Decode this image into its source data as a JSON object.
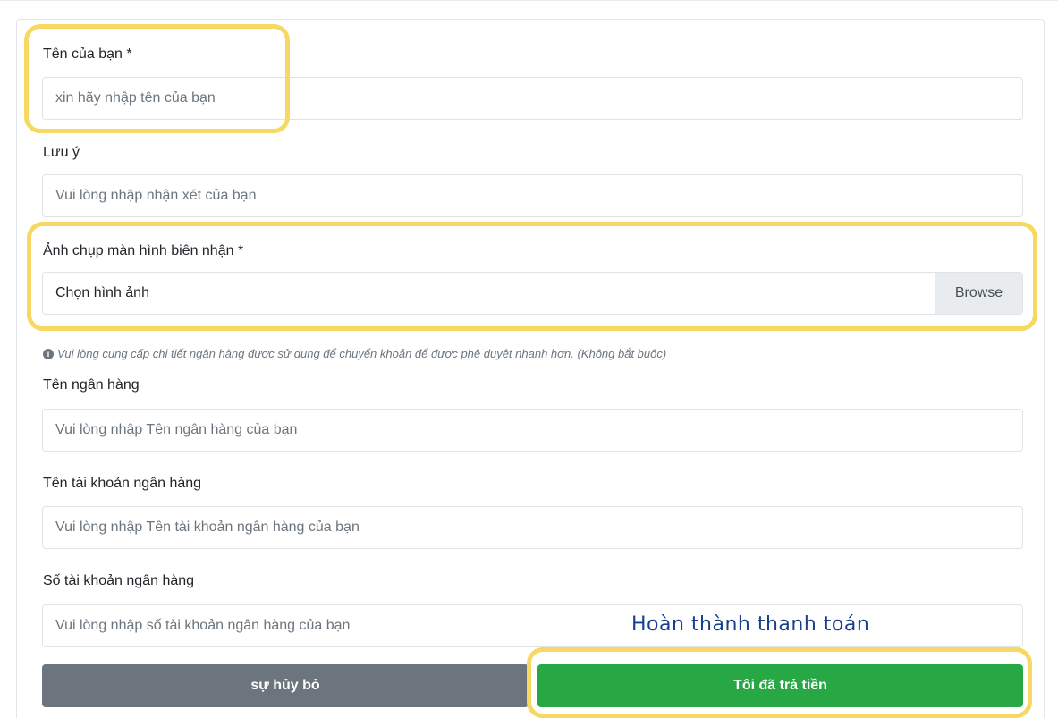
{
  "form": {
    "name_label": "Tên của bạn *",
    "name_placeholder": "xin hãy nhập tên của bạn",
    "note_label": "Lưu ý",
    "note_placeholder": "Vui lòng nhập nhận xét của bạn",
    "receipt_label": "Ảnh chụp màn hình biên nhận *",
    "receipt_placeholder": "Chọn hình ảnh",
    "browse_label": "Browse",
    "hint_text": "Vui lòng cung cấp chi tiết ngân hàng được sử dụng để chuyển khoản để được phê duyệt nhanh hơn. (Không bắt buộc)",
    "bank_name_label": "Tên ngân hàng",
    "bank_name_placeholder": "Vui lòng nhập Tên ngân hàng của bạn",
    "account_name_label": "Tên tài khoản ngân hàng",
    "account_name_placeholder": "Vui lòng nhập Tên tài khoản ngân hàng của bạn",
    "account_number_label": "Số tài khoản ngân hàng",
    "account_number_placeholder": "Vui lòng nhập số tài khoản ngân hàng của bạn"
  },
  "actions": {
    "cancel_label": "sự hủy bỏ",
    "paid_label": "Tôi đã trả tiền"
  },
  "annotation": {
    "callout_text": "Hoàn thành thanh toán",
    "highlight_color": "#f6d862"
  },
  "colors": {
    "cancel_bg": "#6c757d",
    "paid_bg": "#28a745",
    "callout": "#1a3f8f"
  }
}
